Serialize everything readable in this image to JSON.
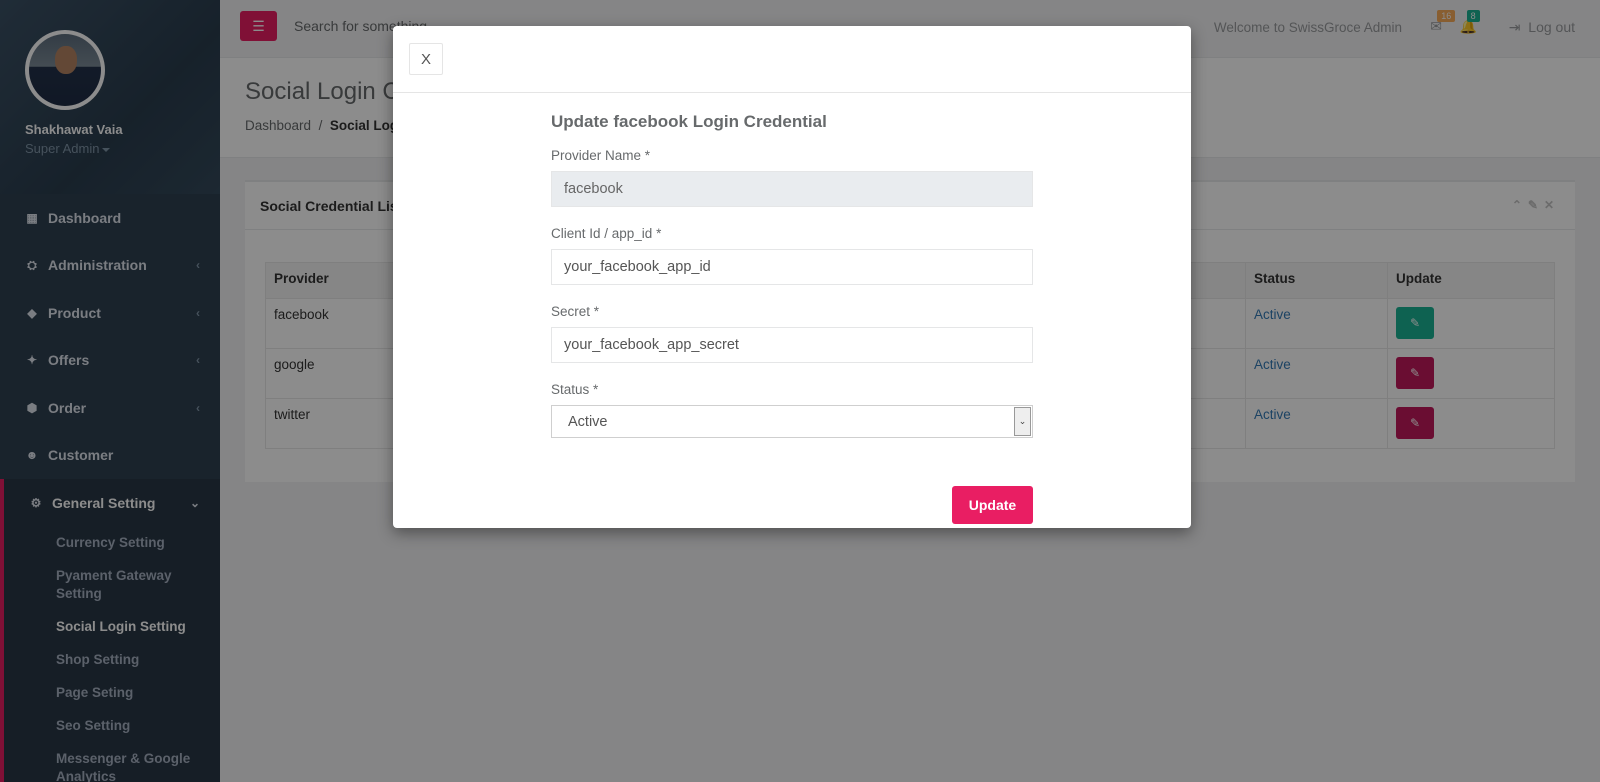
{
  "profile": {
    "name": "Shakhawat Vaia",
    "role": "Super Admin"
  },
  "sidebar": {
    "items": [
      {
        "label": "Dashboard",
        "icon": "dashboard-icon",
        "glyph": "▦",
        "chevron": false
      },
      {
        "label": "Administration",
        "icon": "sitemap-icon",
        "glyph": "⛭",
        "chevron": true
      },
      {
        "label": "Product",
        "icon": "diamond-icon",
        "glyph": "◆",
        "chevron": true
      },
      {
        "label": "Offers",
        "icon": "fire-icon",
        "glyph": "✦",
        "chevron": true
      },
      {
        "label": "Order",
        "icon": "cube-icon",
        "glyph": "⬢",
        "chevron": true
      },
      {
        "label": "Customer",
        "icon": "users-icon",
        "glyph": "☻",
        "chevron": false
      }
    ],
    "active_group": {
      "label": "General Setting",
      "icon": "gear-icon"
    },
    "sub_items": [
      "Currency Setting",
      "Pyament Gateway Setting",
      "Social Login Setting",
      "Shop Setting",
      "Page Seting",
      "Seo Setting",
      "Messenger & Google Analytics"
    ]
  },
  "topbar": {
    "search_placeholder": "Search for something...",
    "welcome": "Welcome to SwissGroce Admin",
    "mail_count": "16",
    "notif_count": "8",
    "logout": "Log out",
    "colors": {
      "mail_badge": "#f8ac59",
      "notif_badge": "#1ab394"
    }
  },
  "page": {
    "title": "Social Login Credential",
    "breadcrumb_home": "Dashboard",
    "breadcrumb_sep": "/",
    "breadcrumb_current": "Social Login Setting"
  },
  "panel": {
    "title": "Social Credential List",
    "columns": {
      "provider": "Provider",
      "status": "Status",
      "update": "Update"
    },
    "rows": [
      {
        "provider": "facebook",
        "status": "Active",
        "btn_color": "#1ab394"
      },
      {
        "provider": "google",
        "status": "Active",
        "btn_color": "#c2185b"
      },
      {
        "provider": "twitter",
        "status": "Active",
        "btn_color": "#c2185b"
      }
    ]
  },
  "modal": {
    "close_label": "X",
    "title": "Update facebook Login Credential",
    "provider_label": "Provider Name *",
    "provider_value": "facebook",
    "client_label": "Client Id / app_id *",
    "client_value": "your_facebook_app_id",
    "secret_label": "Secret *",
    "secret_value": "your_facebook_app_secret",
    "status_label": "Status *",
    "status_value": "Active",
    "update_label": "Update"
  }
}
